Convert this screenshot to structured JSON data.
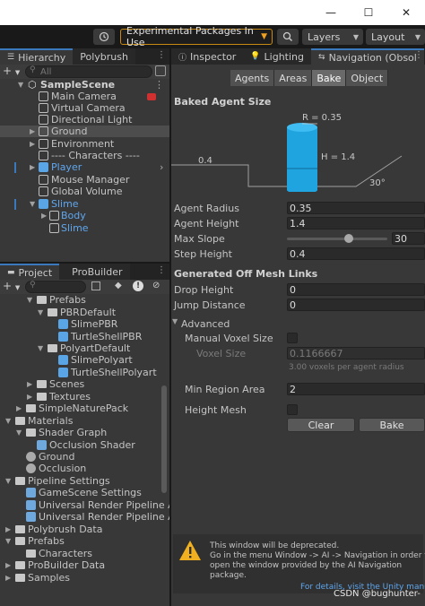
{
  "toolbar": {
    "experimental_label": "Experimental Packages In Use",
    "layers_label": "Layers",
    "layout_label": "Layout"
  },
  "hierarchy": {
    "tabs": [
      "Hierarchy",
      "Polybrush"
    ],
    "search_placeholder": "All",
    "scene_name": "SampleScene",
    "items": [
      "Main Camera",
      "Virtual Camera",
      "Directional Light",
      "Ground",
      "Environment",
      "---- Characters ----",
      "Player",
      "Mouse Manager",
      "Global Volume",
      "Slime",
      "Body",
      "Slime"
    ]
  },
  "project": {
    "tabs": [
      "Project",
      "ProBuilder"
    ],
    "items": [
      "Prefabs",
      "PBRDefault",
      "SlimePBR",
      "TurtleShellPBR",
      "PolyartDefault",
      "SlimePolyart",
      "TurtleShellPolyart",
      "Scenes",
      "Textures",
      "SimpleNaturePack",
      "Materials",
      "Shader Graph",
      "Occlusion Shader",
      "Ground",
      "Occlusion",
      "Pipeline Settings",
      "GameScene Settings",
      "Universal Render Pipeline A",
      "Universal Render Pipeline A",
      "Polybrush Data",
      "Prefabs",
      "Characters",
      "ProBuilder Data",
      "Samples"
    ]
  },
  "inspector": {
    "tabs": [
      "Inspector",
      "Lighting",
      "Navigation (Obsol"
    ],
    "nav_tabs": [
      "Agents",
      "Areas",
      "Bake",
      "Object"
    ],
    "baked_agent_size": "Baked Agent Size",
    "diagram": {
      "r_label": "R = 0.35",
      "h_label": "H = 1.4",
      "step_label": "0.4",
      "slope_label": "30°"
    },
    "agent_radius_label": "Agent Radius",
    "agent_radius": "0.35",
    "agent_height_label": "Agent Height",
    "agent_height": "1.4",
    "max_slope_label": "Max Slope",
    "max_slope": "30",
    "max_slope_fraction": 0.62,
    "step_height_label": "Step Height",
    "step_height": "0.4",
    "offmesh_header": "Generated Off Mesh Links",
    "drop_height_label": "Drop Height",
    "drop_height": "0",
    "jump_distance_label": "Jump Distance",
    "jump_distance": "0",
    "advanced_label": "Advanced",
    "manual_voxel_label": "Manual Voxel Size",
    "voxel_size_label": "Voxel Size",
    "voxel_size": "0.1166667",
    "voxel_hint": "3.00 voxels per agent radius",
    "min_region_label": "Min Region Area",
    "min_region": "2",
    "height_mesh_label": "Height Mesh",
    "clear_label": "Clear",
    "bake_label": "Bake",
    "warning_text_1": "This window will be deprecated.",
    "warning_text_2": "Go in the menu Window -> AI -> Navigation in order to",
    "warning_text_3": "open the window provided by the AI Navigation",
    "warning_text_4": "package.",
    "details_link": "For details, visit the Unity manual",
    "watermark": "CSDN @bughunter-"
  },
  "colors": {
    "accent": "#3a79bb",
    "warning": "#f0a020",
    "cylinder": "#1fa4e0",
    "selection": "#4d4d4d"
  }
}
